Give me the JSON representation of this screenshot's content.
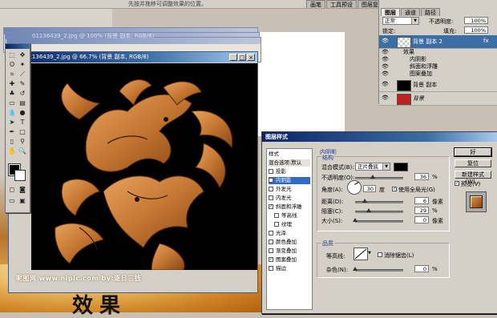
{
  "hint_text": "先按并拖移可调整效果的位置。",
  "doc_tabs": [
    "画笔",
    "工具预设",
    "图层复合"
  ],
  "document": {
    "title": "01136439_2.jpg @ 66.7% (背景 副本, RGB/8)",
    "ghost_title": "01136439_2.jpg @ 100% (背景 副本, RGB/8)"
  },
  "watermark": "昵图网 www.nipic.com  by:逐日三钱",
  "big_title": "效果",
  "layers_panel": {
    "tabs": [
      "图层",
      "通道",
      "路径"
    ],
    "blend_mode": "正常",
    "opacity_label": "不透明度:",
    "opacity_value": "100%",
    "lock_label": "锁定:",
    "fill_label": "填充:",
    "fill_value": "100%",
    "layers": [
      {
        "name": "背景 副本 2",
        "selected": true,
        "fx": "fx"
      },
      {
        "name": "背景 副本",
        "selected": false
      },
      {
        "name": "背景",
        "selected": false,
        "italic": true
      }
    ],
    "effects_header": "效果",
    "effects": [
      "内阴影",
      "斜面和浮雕",
      "图案叠加"
    ]
  },
  "dialog": {
    "title": "图层样式",
    "list": [
      {
        "label": "样式",
        "header": true
      },
      {
        "label": "混合选项:默认",
        "header": true
      },
      {
        "label": "投影",
        "checked": false
      },
      {
        "label": "内阴影",
        "checked": true,
        "selected": true
      },
      {
        "label": "外发光",
        "checked": false
      },
      {
        "label": "内发光",
        "checked": false
      },
      {
        "label": "斜面和浮雕",
        "checked": true
      },
      {
        "label": "等高线",
        "checked": false,
        "indent": true
      },
      {
        "label": "纹理",
        "checked": false,
        "indent": true
      },
      {
        "label": "光泽",
        "checked": false
      },
      {
        "label": "颜色叠加",
        "checked": false
      },
      {
        "label": "渐变叠加",
        "checked": false
      },
      {
        "label": "图案叠加",
        "checked": true
      },
      {
        "label": "描边",
        "checked": false
      }
    ],
    "section_title": "内阴影",
    "structure_title": "结构",
    "blend_mode_label": "混合模式(B):",
    "blend_mode_value": "正片叠底",
    "blend_color": "#000000",
    "opacity_label": "不透明度(O):",
    "opacity_value": "36",
    "angle_label": "角度(A):",
    "angle_value": "30",
    "angle_unit": "度",
    "global_light_label": "使用全局光(G)",
    "global_light_checked": true,
    "distance_label": "距离(D):",
    "distance_value": "6",
    "choke_label": "阻塞(C):",
    "choke_value": "29",
    "size_label": "大小(S):",
    "size_value": "0",
    "unit_px": "像素",
    "unit_pct": "%",
    "quality_title": "品质",
    "contour_label": "等高线:",
    "antialias_label": "消除锯齿(L)",
    "noise_label": "杂色(N):",
    "noise_value": "0",
    "sliders": {
      "opacity": 0.36,
      "distance": 0.2,
      "choke": 0.29,
      "size": 0.0,
      "noise": 0.0
    },
    "buttons": {
      "ok": "好",
      "reset": "复位",
      "new_style": "新建样式(W)...",
      "preview": "预览(V)"
    },
    "preview_checked": true
  },
  "colors": {
    "title_bar": "#0a246a",
    "selection": "#316ac5",
    "wood": "#c77a35"
  }
}
